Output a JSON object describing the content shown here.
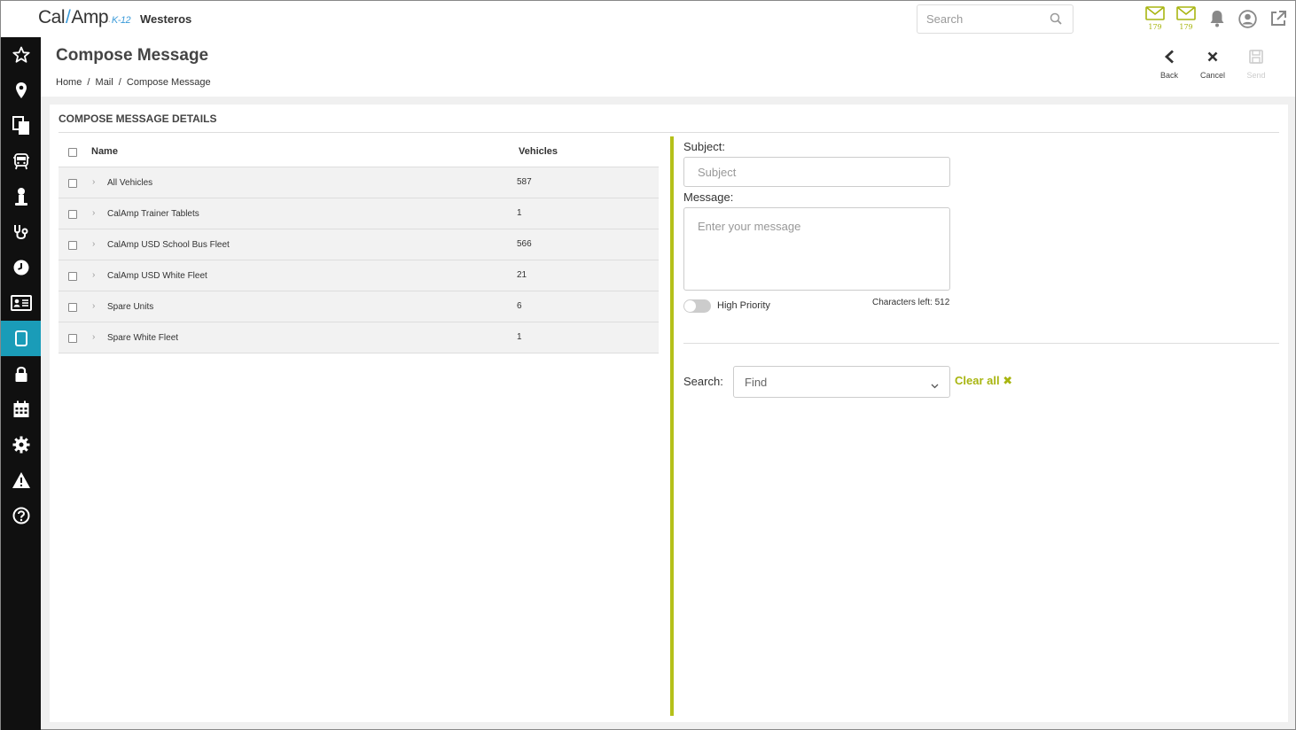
{
  "topbar": {
    "logo_main": "Cal",
    "logo_amp": "Amp",
    "logo_tm": "·",
    "logo_k12": "K-12",
    "org_name": "Westeros",
    "search_placeholder": "Search",
    "mail_count_1": "179",
    "mail_count_2": "179"
  },
  "sidebar": {
    "items": [
      {
        "icon": "star-icon",
        "active": false
      },
      {
        "icon": "map-pin-icon",
        "active": false
      },
      {
        "icon": "documents-icon",
        "active": false
      },
      {
        "icon": "bus-icon",
        "active": false
      },
      {
        "icon": "person-icon",
        "active": false
      },
      {
        "icon": "stethoscope-icon",
        "active": false
      },
      {
        "icon": "clock-icon",
        "active": false
      },
      {
        "icon": "id-card-icon",
        "active": false
      },
      {
        "icon": "tablet-icon",
        "active": true
      },
      {
        "icon": "lock-icon",
        "active": false
      },
      {
        "icon": "calendar-icon",
        "active": false
      },
      {
        "icon": "gear-icon",
        "active": false
      },
      {
        "icon": "warning-icon",
        "active": false
      },
      {
        "icon": "help-icon",
        "active": false
      }
    ]
  },
  "header": {
    "title": "Compose Message",
    "breadcrumb": [
      "Home",
      "/",
      "Mail",
      "/",
      "Compose Message"
    ],
    "actions": {
      "back": "Back",
      "cancel": "Cancel",
      "send": "Send"
    }
  },
  "panel": {
    "title": "COMPOSE MESSAGE DETAILS",
    "table": {
      "col_name": "Name",
      "col_vehicles": "Vehicles",
      "rows": [
        {
          "name": "All Vehicles",
          "vehicles": "587"
        },
        {
          "name": "CalAmp Trainer Tablets",
          "vehicles": "1"
        },
        {
          "name": "CalAmp USD School Bus Fleet",
          "vehicles": "566"
        },
        {
          "name": "CalAmp USD White Fleet",
          "vehicles": "21"
        },
        {
          "name": "Spare Units",
          "vehicles": "6"
        },
        {
          "name": "Spare White Fleet",
          "vehicles": "1"
        }
      ]
    },
    "form": {
      "subject_label": "Subject:",
      "subject_placeholder": "Subject",
      "message_label": "Message:",
      "message_placeholder": "Enter your message",
      "high_priority": "High Priority",
      "chars_left": "Characters left: 512",
      "search_label": "Search:",
      "find_value": "Find",
      "clear_all": "Clear all ✖"
    }
  },
  "colors": {
    "accent": "#a8b510",
    "sidebar_bg": "#101010",
    "sidebar_active": "#1a9cb8",
    "divider": "#b5c01a"
  }
}
